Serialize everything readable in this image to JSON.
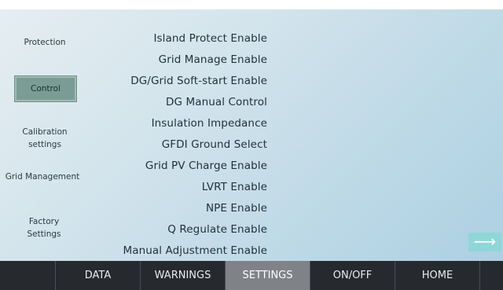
{
  "menu": {
    "items": [
      {
        "label": "Protection"
      },
      {
        "label": "Control"
      },
      {
        "label": "Calibration settings"
      },
      {
        "label": "Grid Management"
      },
      {
        "label": "Factory Settings"
      }
    ]
  },
  "settings": {
    "items": [
      {
        "label": "Island Protect Enable"
      },
      {
        "label": "Grid Manage Enable"
      },
      {
        "label": "DG/Grid Soft-start Enable"
      },
      {
        "label": "DG Manual Control"
      },
      {
        "label": "Insulation Impedance"
      },
      {
        "label": "GFDI Ground Select"
      },
      {
        "label": "Grid PV Charge Enable"
      },
      {
        "label": "LVRT Enable"
      },
      {
        "label": "NPE Enable"
      },
      {
        "label": "Q Regulate Enable"
      },
      {
        "label": "Manual Adjustment Enable"
      }
    ]
  },
  "next_arrow": {
    "glyph": "⟶",
    "icon": "right-arrow-icon"
  },
  "navbar": {
    "items": [
      {
        "label": "DATA"
      },
      {
        "label": "WARNINGS"
      },
      {
        "label": "SETTINGS"
      },
      {
        "label": "ON/OFF"
      },
      {
        "label": "HOME"
      }
    ],
    "active": "SETTINGS"
  },
  "colors": {
    "active_menu": "#7a9c95",
    "navbar": "#262a2f",
    "active_nav": "#7f8388",
    "arrow_button": "#8fd6d6"
  }
}
